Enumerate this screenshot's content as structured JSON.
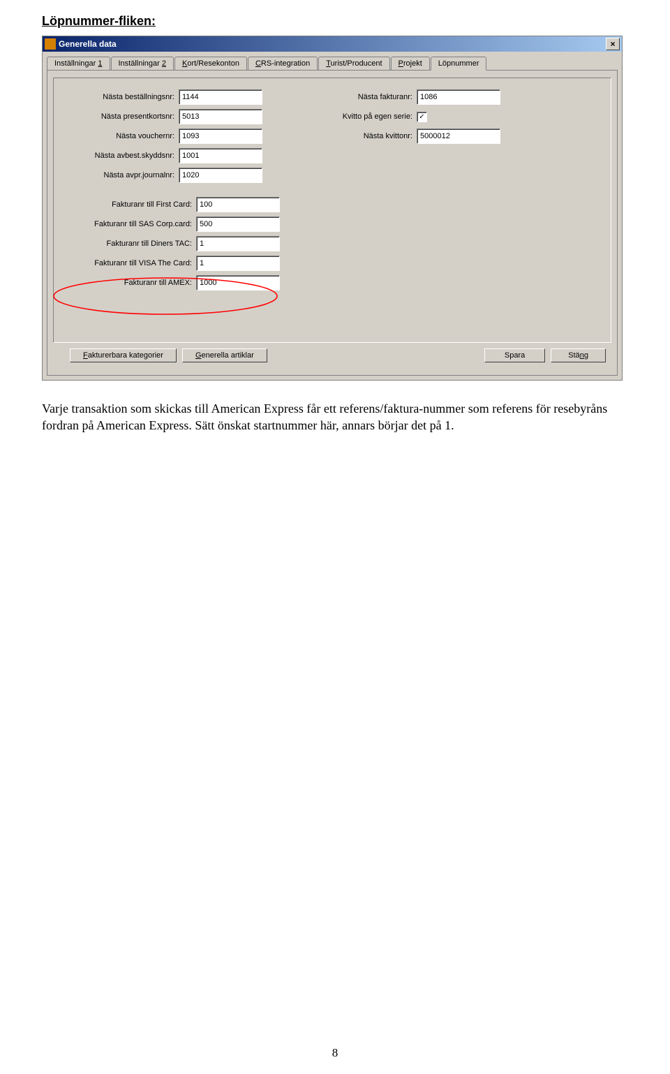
{
  "page": {
    "heading": "Löpnummer-fliken:",
    "bodyText": "Varje transaktion som skickas till American Express får ett referens/faktura-nummer som referens för resebyråns fordran på American Express. Sätt önskat startnummer här, annars börjar det på 1.",
    "pageNumber": "8"
  },
  "window": {
    "title": "Generella data",
    "closeGlyph": "×",
    "tabs": [
      {
        "label": "Inställningar ",
        "mn": "1"
      },
      {
        "label": "Inställningar ",
        "mn": "2"
      },
      {
        "mn": "K",
        "label": "ort/Resekonton"
      },
      {
        "mn": "C",
        "label": "RS-integration"
      },
      {
        "mn": "T",
        "label": "urist/Producent"
      },
      {
        "mn": "P",
        "label": "rojekt"
      },
      {
        "label": "Löpnummer",
        "active": true
      }
    ],
    "fields": {
      "nastaBestallningsnr": {
        "label": "Nästa beställningsnr:",
        "value": "1144"
      },
      "nastaPresentkortsnr": {
        "label": "Nästa presentkortsnr:",
        "value": "5013"
      },
      "nastaVouchernr": {
        "label": "Nästa vouchernr:",
        "value": "1093"
      },
      "nastaAvbestSkyddsnr": {
        "label": "Nästa avbest.skyddsnr:",
        "value": "1001"
      },
      "nastaAvprJournalnr": {
        "label": "Nästa avpr.journalnr:",
        "value": "1020"
      },
      "nastaFakturanr": {
        "label": "Nästa fakturanr:",
        "value": "1086"
      },
      "kvittoEgenSerie": {
        "label": "Kvitto på egen serie:",
        "checked": "✓"
      },
      "nastaKvittonr": {
        "label": "Nästa kvittonr:",
        "value": "5000012"
      },
      "fakturanrFirstCard": {
        "label": "Fakturanr till First Card:",
        "value": "100"
      },
      "fakturanrSAS": {
        "label": "Fakturanr till SAS Corp.card:",
        "value": "500"
      },
      "fakturanrDiners": {
        "label": "Fakturanr till Diners TAC:",
        "value": "1"
      },
      "fakturanrVISA": {
        "label": "Fakturanr till VISA The Card:",
        "value": "1"
      },
      "fakturanrAMEX": {
        "label": "Fakturanr till AMEX:",
        "value": "1000"
      }
    },
    "buttons": {
      "fakturerbara": {
        "mn": "F",
        "label": "akturerbara kategorier"
      },
      "generella": {
        "mn": "G",
        "label": "enerella artiklar"
      },
      "spara": {
        "label": "Spara"
      },
      "stang": {
        "label": "Stä",
        "mn": "n",
        "label2": "g"
      }
    }
  }
}
